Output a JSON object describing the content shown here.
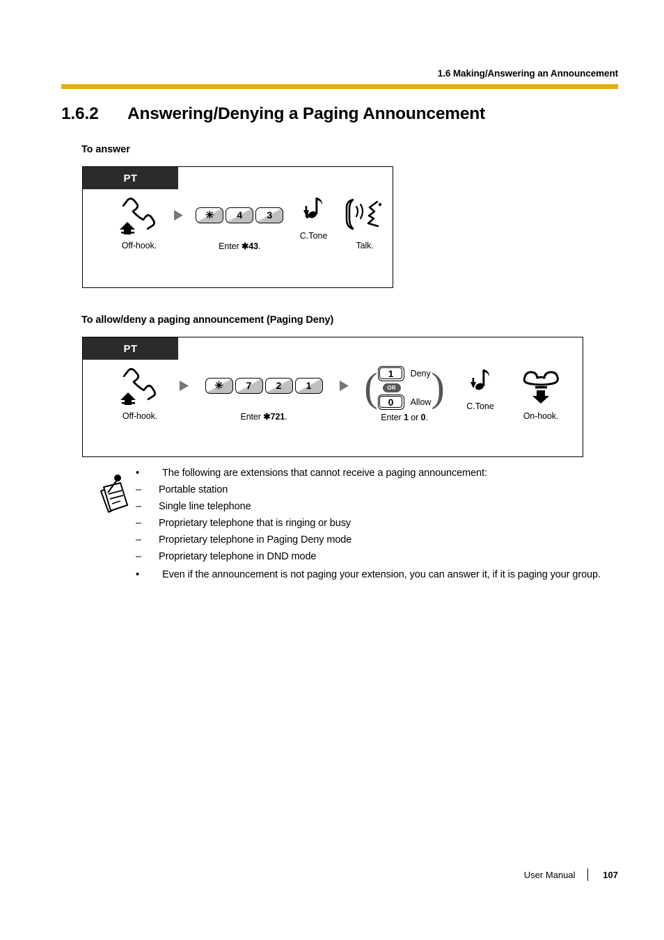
{
  "header": {
    "running_title": "1.6 Making/Answering an Announcement",
    "rule_color": "#E0AF0C"
  },
  "section": {
    "number": "1.6.2",
    "title": "Answering/Denying a Paging Announcement"
  },
  "subheads": {
    "answer": "To answer",
    "deny": "To allow/deny a paging announcement (Paging Deny)"
  },
  "diagram_answer": {
    "phone_type": "PT",
    "steps": [
      {
        "icon": "off-hook-handset-icon",
        "caption": "Off-hook."
      },
      {
        "icon": "arrow-right-icon"
      },
      {
        "keys": [
          "✳",
          "4",
          "3"
        ],
        "caption_prefix": "Enter ",
        "caption_code": "✱43",
        "caption_suffix": "."
      },
      {
        "icon": "tone-note-icon",
        "label": "C.Tone"
      },
      {
        "icon": "talk-handset-icon",
        "caption": "Talk."
      }
    ]
  },
  "diagram_deny": {
    "phone_type": "PT",
    "steps": [
      {
        "icon": "off-hook-handset-icon",
        "caption": "Off-hook."
      },
      {
        "icon": "arrow-right-icon"
      },
      {
        "keys": [
          "✳",
          "7",
          "2",
          "1"
        ],
        "caption_prefix": "Enter ",
        "caption_code": "✱721",
        "caption_suffix": "."
      },
      {
        "icon": "arrow-right-icon"
      },
      {
        "choice": {
          "or_label": "OR",
          "options": [
            {
              "key": "1",
              "label": "Deny"
            },
            {
              "key": "0",
              "label": "Allow"
            }
          ]
        },
        "caption_prefix": "Enter ",
        "caption_a": "1",
        "caption_mid": " or ",
        "caption_b": "0",
        "caption_suffix": "."
      },
      {
        "icon": "tone-note-icon",
        "label": "C.Tone"
      },
      {
        "icon": "on-hook-handset-icon",
        "caption": "On-hook."
      }
    ]
  },
  "note": {
    "icon": "note-memo-icon",
    "bullet_char": "•",
    "dash_char": "–",
    "items": [
      {
        "text": "The following are extensions that cannot receive a paging announcement:",
        "subitems": [
          "Portable station",
          "Single line telephone",
          "Proprietary telephone that is ringing or busy",
          "Proprietary telephone in Paging Deny mode",
          "Proprietary telephone in DND mode"
        ]
      },
      {
        "text": "Even if the announcement is not paging your extension, you can answer it, if it is paging your group.",
        "subitems": []
      }
    ]
  },
  "footer": {
    "doc_title": "User Manual",
    "page_number": "107"
  }
}
